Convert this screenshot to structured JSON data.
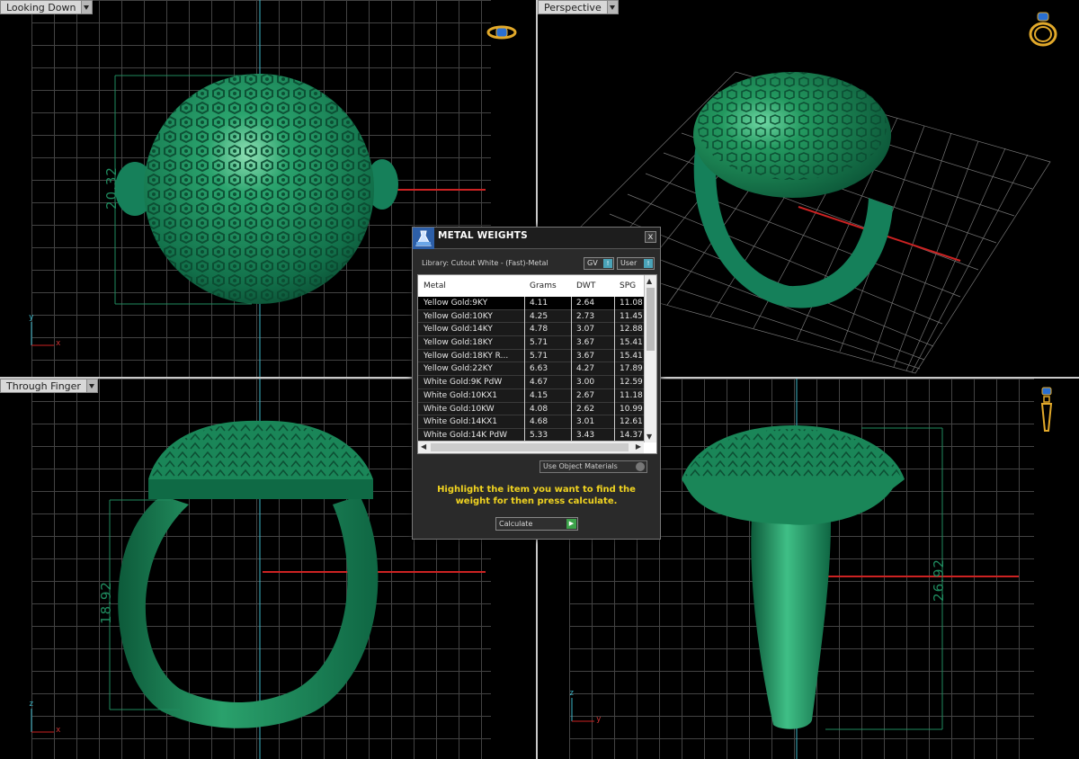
{
  "viewports": {
    "top_left": {
      "label": "Looking Down",
      "dimension": "20.32",
      "axis_y": "y",
      "axis_x": "x"
    },
    "top_right": {
      "label": "Perspective"
    },
    "bottom_left": {
      "label": "Through Finger",
      "dimension": "18.92",
      "axis_z": "z",
      "axis_x": "x"
    },
    "bottom_right": {
      "label": "",
      "dimension": "26.92",
      "axis_z": "z",
      "axis_y": "y"
    }
  },
  "dialog": {
    "title": "METAL WEIGHTS",
    "close": "x",
    "library": "Library: Cutout White - (Fast)-Metal",
    "toggle_gv": "GV",
    "toggle_user": "User",
    "table": {
      "headers": [
        "Metal",
        "Grams",
        "DWT",
        "SPG"
      ],
      "rows": [
        [
          "Yellow Gold:9KY",
          "4.11",
          "2.64",
          "11.08"
        ],
        [
          "Yellow Gold:10KY",
          "4.25",
          "2.73",
          "11.45"
        ],
        [
          "Yellow Gold:14KY",
          "4.78",
          "3.07",
          "12.88"
        ],
        [
          "Yellow Gold:18KY",
          "5.71",
          "3.67",
          "15.41"
        ],
        [
          "Yellow Gold:18KY R...",
          "5.71",
          "3.67",
          "15.41"
        ],
        [
          "Yellow Gold:22KY",
          "6.63",
          "4.27",
          "17.89"
        ],
        [
          "White Gold:9K PdW",
          "4.67",
          "3.00",
          "12.59"
        ],
        [
          "White Gold:10KX1",
          "4.15",
          "2.67",
          "11.18"
        ],
        [
          "White Gold:10KW",
          "4.08",
          "2.62",
          "10.99"
        ],
        [
          "White Gold:14KX1",
          "4.68",
          "3.01",
          "12.61"
        ],
        [
          "White Gold:14K PdW",
          "5.33",
          "3.43",
          "14.37"
        ]
      ]
    },
    "use_object_materials": "Use Object Materials",
    "hint": "Highlight the item you want to find the weight for then press calculate.",
    "calculate": "Calculate"
  },
  "colors": {
    "model_green": "#1e8e5c",
    "dimension_green": "#1f8a5e",
    "axis_red": "#cc2222",
    "axis_cyan": "#3cb6c8",
    "hint_yellow": "#f0d320"
  }
}
